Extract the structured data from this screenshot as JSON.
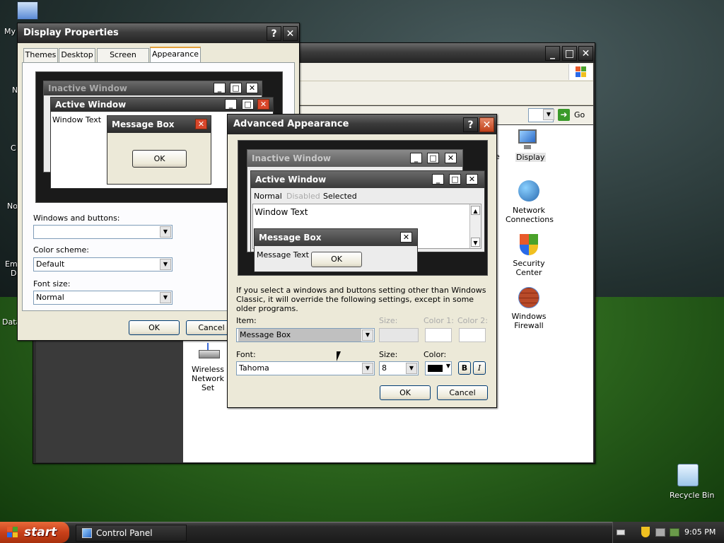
{
  "desktop": {
    "labels": [
      "My",
      "N",
      "C",
      "No",
      "Em",
      "D",
      "Data"
    ],
    "recycle_bin": "Recycle Bin"
  },
  "control_panel": {
    "go_label": "Go",
    "icons": [
      {
        "label": "Display"
      },
      {
        "label": "Network Connections"
      },
      {
        "label": "Security Center"
      },
      {
        "label": "Windows Firewall"
      },
      {
        "label": "Wireless Network Set"
      }
    ],
    "partial_e": "e"
  },
  "display_properties": {
    "title": "Display Properties",
    "tabs": [
      "Themes",
      "Desktop",
      "Screen Saver",
      "Appearance"
    ],
    "selected_tab": "Appearance",
    "preview": {
      "inactive_title": "Inactive Window",
      "active_title": "Active Window",
      "window_text": "Window Text",
      "msgbox_title": "Message Box",
      "ok": "OK"
    },
    "windows_buttons_label": "Windows and buttons:",
    "windows_buttons_value": "",
    "color_scheme_label": "Color scheme:",
    "color_scheme_value": "Default",
    "font_size_label": "Font size:",
    "font_size_value": "Normal",
    "ok": "OK",
    "cancel": "Cancel"
  },
  "advanced": {
    "title": "Advanced Appearance",
    "preview": {
      "inactive_title": "Inactive Window",
      "active_title": "Active Window",
      "menu_normal": "Normal",
      "menu_disabled": "Disabled",
      "menu_selected": "Selected",
      "window_text": "Window Text",
      "msgbox_title": "Message Box",
      "msgbox_text": "Message Text",
      "ok": "OK"
    },
    "info": "If you select a windows and buttons setting other than Windows Classic, it will override the following settings, except in some older programs.",
    "item_label": "Item:",
    "item_value": "Message Box",
    "size_label_1": "Size:",
    "color1_label": "Color 1:",
    "color2_label": "Color 2:",
    "font_label": "Font:",
    "font_value": "Tahoma",
    "size_label_2": "Size:",
    "size_value": "8",
    "color_label": "Color:",
    "bold": "B",
    "italic": "I",
    "ok": "OK",
    "cancel": "Cancel"
  },
  "taskbar": {
    "start": "start",
    "task": "Control Panel",
    "clock": "9:05 PM"
  }
}
